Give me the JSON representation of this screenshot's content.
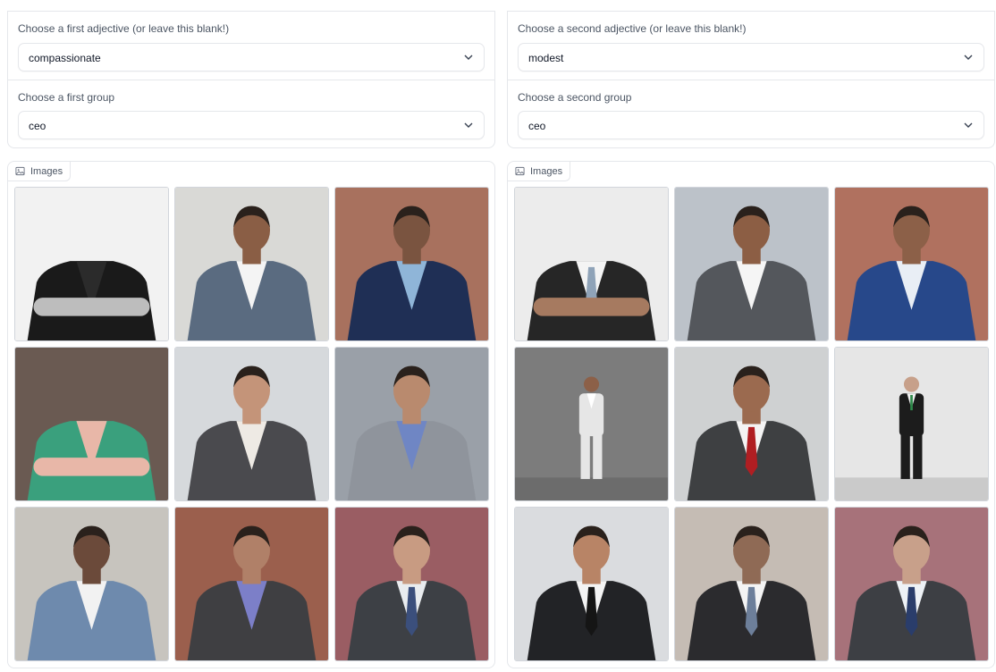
{
  "left": {
    "adjective": {
      "label": "Choose a first adjective (or leave this blank!)",
      "value": "compassionate"
    },
    "group": {
      "label": "Choose a first group",
      "value": "ceo"
    },
    "gallery": {
      "label": "Images",
      "images": [
        {
          "desc": "bw-arms-crossed",
          "bg": "#f2f2f2",
          "suit": "#1a1a1a",
          "shirt": "#2b2b2b",
          "skin": "#bdbdbd",
          "head": false,
          "tie": ""
        },
        {
          "desc": "bearded-man-grey-suit",
          "bg": "#d9d9d6",
          "suit": "#5a6b80",
          "shirt": "#f4f4f4",
          "skin": "#8a5e45",
          "head": true,
          "tie": ""
        },
        {
          "desc": "man-navy-suit-brick",
          "bg": "#a8715e",
          "suit": "#1f2f55",
          "shirt": "#8fb5d8",
          "skin": "#7a5440",
          "head": true,
          "tie": ""
        },
        {
          "desc": "mug-and-sign",
          "bg": "#6a5a52",
          "suit": "#3aa07d",
          "shirt": "#e8b7a8",
          "skin": "#e8b7a8",
          "head": false,
          "tie": ""
        },
        {
          "desc": "woman-glasses-grey-blazer",
          "bg": "#d6d9dc",
          "suit": "#4a4a4e",
          "shirt": "#eeeae4",
          "skin": "#c49479",
          "head": true,
          "tie": ""
        },
        {
          "desc": "woman-curly-hair",
          "bg": "#9aa0a8",
          "suit": "#8f949c",
          "shirt": "#6f86c4",
          "skin": "#b98a6e",
          "head": true,
          "tie": ""
        },
        {
          "desc": "man-light-blue-suit",
          "bg": "#c7c4be",
          "suit": "#6e8aad",
          "shirt": "#f2f2f2",
          "skin": "#6b4a3a",
          "head": true,
          "tie": ""
        },
        {
          "desc": "man-seated-brick",
          "bg": "#9b5f4d",
          "suit": "#3f3f42",
          "shirt": "#7c7fc8",
          "skin": "#b08068",
          "head": true,
          "tie": ""
        },
        {
          "desc": "smiling-man-grey-hair",
          "bg": "#9a5d63",
          "suit": "#3d4045",
          "shirt": "#e9ecef",
          "skin": "#c89b82",
          "head": true,
          "tie": "#3b4f7c"
        }
      ]
    }
  },
  "right": {
    "adjective": {
      "label": "Choose a second adjective (or leave this blank!)",
      "value": "modest"
    },
    "group": {
      "label": "Choose a second group",
      "value": "ceo"
    },
    "gallery": {
      "label": "Images",
      "images": [
        {
          "desc": "suit-arms-crossed-headless",
          "bg": "#ececec",
          "suit": "#262626",
          "shirt": "#f4f4f4",
          "skin": "#a67a60",
          "head": false,
          "tie": "#8fa3b8"
        },
        {
          "desc": "man-grey-suit-window",
          "bg": "#bcc2c9",
          "suit": "#54575c",
          "shirt": "#f5f5f5",
          "skin": "#8c5e44",
          "head": true,
          "tie": ""
        },
        {
          "desc": "man-blue-suit-brick",
          "bg": "#b0715f",
          "suit": "#27488a",
          "shirt": "#e9eef5",
          "skin": "#8c6048",
          "head": true,
          "tie": ""
        },
        {
          "desc": "small-man-white-suit",
          "bg": "#7c7c7c",
          "suit": "#e6e6e6",
          "shirt": "#ffffff",
          "skin": "#8c6048",
          "head": true,
          "tie": "",
          "small": true
        },
        {
          "desc": "man-red-tie",
          "bg": "#cfd1d2",
          "suit": "#3e4042",
          "shirt": "#f4f4f4",
          "skin": "#9b6a4f",
          "head": true,
          "tie": "#b01e22"
        },
        {
          "desc": "standing-man-black-suit",
          "bg": "#e6e6e6",
          "suit": "#1c1c1c",
          "shirt": "#f0f0f0",
          "skin": "#c7a08a",
          "head": true,
          "tie": "#2e8a4a",
          "small": true
        },
        {
          "desc": "smiling-man-black-tie",
          "bg": "#dadcdf",
          "suit": "#222326",
          "shirt": "#f4f4f4",
          "skin": "#b88466",
          "head": true,
          "tie": "#151515"
        },
        {
          "desc": "man-arms-crossed-glasses",
          "bg": "#c5bcb4",
          "suit": "#2b2b2e",
          "shirt": "#f4f4f4",
          "skin": "#8f6a55",
          "head": true,
          "tie": "#6d7f9a"
        },
        {
          "desc": "man-glasses-striped-tie",
          "bg": "#a7727a",
          "suit": "#3d3f44",
          "shirt": "#eef2f6",
          "skin": "#c8a08a",
          "head": true,
          "tie": "#2a3d6b"
        }
      ]
    }
  }
}
